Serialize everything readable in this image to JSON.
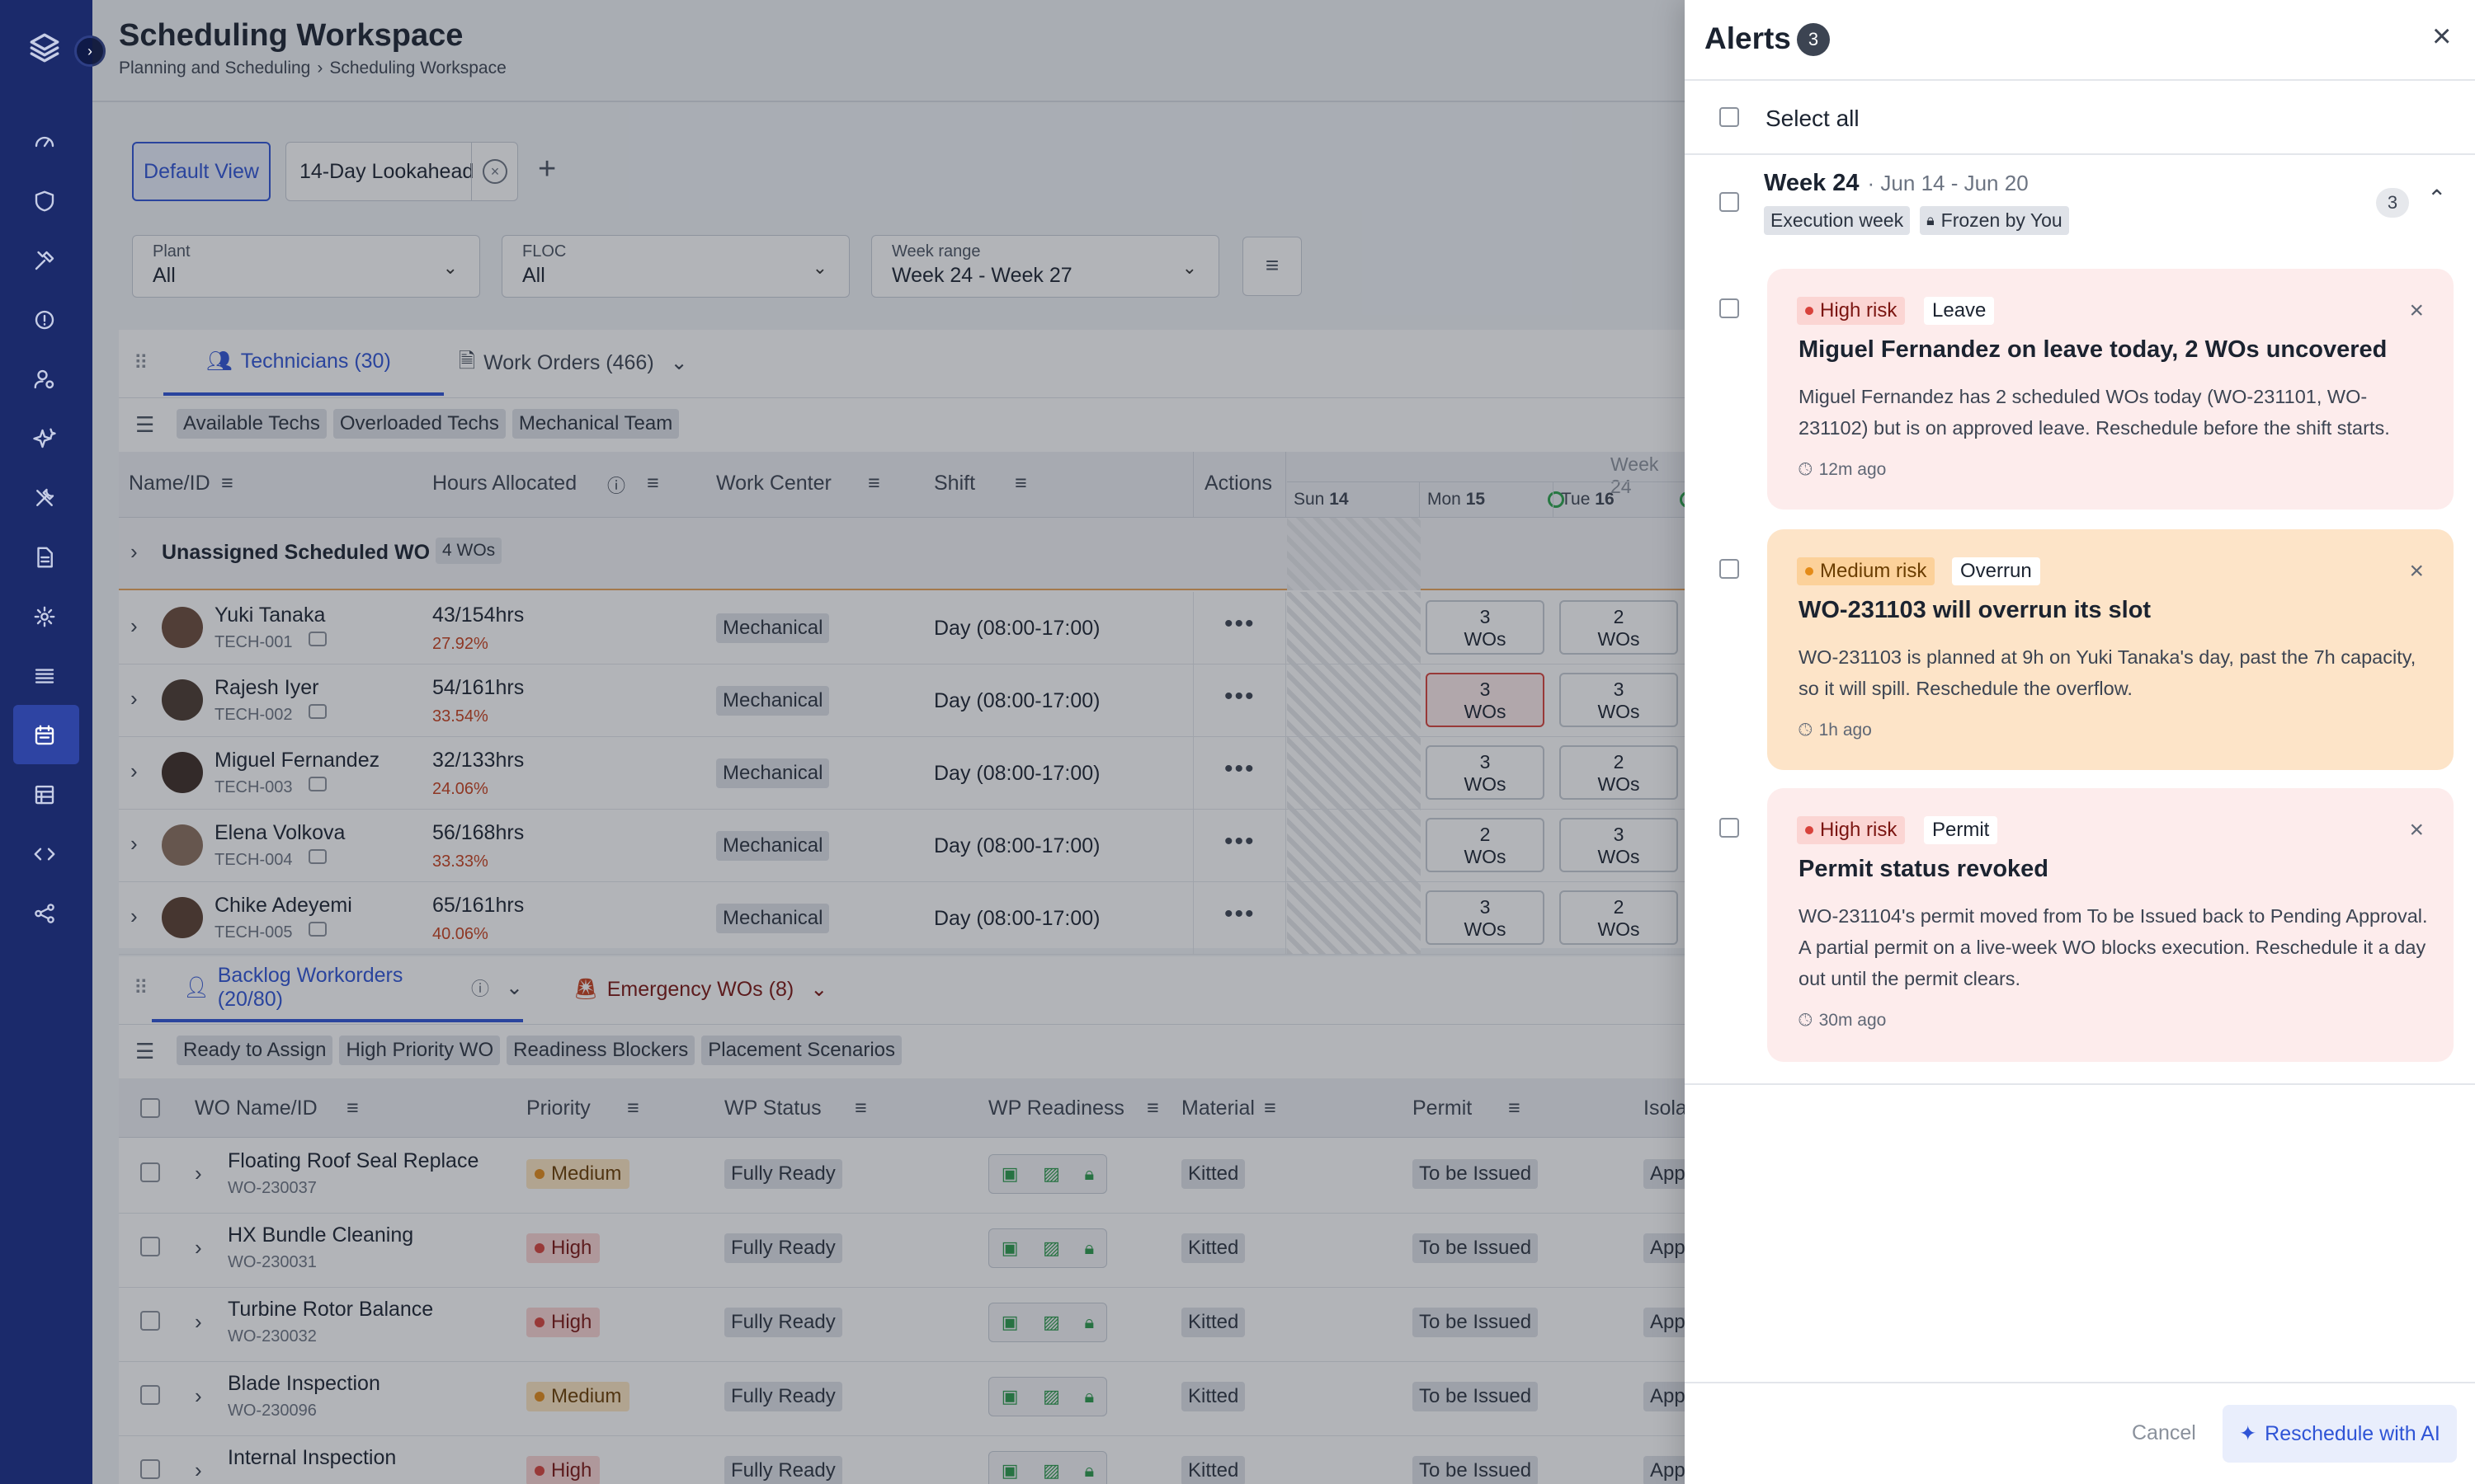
{
  "header": {
    "title": "Scheduling Workspace",
    "breadcrumb": [
      "Planning and Scheduling",
      "Scheduling Workspace"
    ]
  },
  "views": {
    "tabs": [
      {
        "label": "Default View",
        "active": true
      },
      {
        "label": "14-Day Lookahead",
        "active": false
      }
    ]
  },
  "filters": [
    {
      "label": "Plant",
      "value": "All"
    },
    {
      "label": "FLOC",
      "value": "All"
    },
    {
      "label": "Week range",
      "value": "Week 24 - Week 27"
    }
  ],
  "tech_panel": {
    "tabs": [
      {
        "label": "Technicians (30)",
        "active": true
      },
      {
        "label": "Work Orders (466)",
        "active": false
      }
    ],
    "chips": [
      "Available Techs",
      "Overloaded Techs",
      "Mechanical Team"
    ],
    "columns": [
      "Name/ID",
      "Hours Allocated",
      "Work Center",
      "Shift",
      "Actions"
    ],
    "week_label": "Week 24",
    "days": [
      {
        "dow": "Sun",
        "num": "14"
      },
      {
        "dow": "Mon",
        "num": "15"
      },
      {
        "dow": "Tue",
        "num": "16"
      }
    ],
    "unassigned": {
      "label": "Unassigned Scheduled WO",
      "count": "4 WOs"
    },
    "rows": [
      {
        "name": "Yuki Tanaka",
        "id": "TECH-001",
        "hours": "43/154hrs",
        "pct": "27.92%",
        "center": "Mechanical",
        "shift": "Day (08:00-17:00)",
        "mon": [
          "3",
          "WOs"
        ],
        "tue": [
          "2",
          "WOs"
        ]
      },
      {
        "name": "Rajesh Iyer",
        "id": "TECH-002",
        "hours": "54/161hrs",
        "pct": "33.54%",
        "center": "Mechanical",
        "shift": "Day (08:00-17:00)",
        "mon": [
          "3",
          "WOs"
        ],
        "tue": [
          "3",
          "WOs"
        ]
      },
      {
        "name": "Miguel Fernandez",
        "id": "TECH-003",
        "hours": "32/133hrs",
        "pct": "24.06%",
        "center": "Mechanical",
        "shift": "Day (08:00-17:00)",
        "mon": [
          "3",
          "WOs"
        ],
        "tue": [
          "2",
          "WOs"
        ]
      },
      {
        "name": "Elena Volkova",
        "id": "TECH-004",
        "hours": "56/168hrs",
        "pct": "33.33%",
        "center": "Mechanical",
        "shift": "Day (08:00-17:00)",
        "mon": [
          "2",
          "WOs"
        ],
        "tue": [
          "3",
          "WOs"
        ]
      },
      {
        "name": "Chike Adeyemi",
        "id": "TECH-005",
        "hours": "65/161hrs",
        "pct": "40.06%",
        "center": "Mechanical",
        "shift": "Day (08:00-17:00)",
        "mon": [
          "3",
          "WOs"
        ],
        "tue": [
          "2",
          "WOs"
        ]
      }
    ]
  },
  "backlog_panel": {
    "tabs": [
      {
        "label": "Backlog Workorders (20/80)",
        "active": true
      },
      {
        "label": "Emergency WOs (8)",
        "active": false
      }
    ],
    "chips": [
      "Ready to Assign",
      "High Priority WO",
      "Readiness Blockers",
      "Placement Scenarios"
    ],
    "columns": [
      "WO Name/ID",
      "Priority",
      "WP Status",
      "WP Readiness",
      "Material",
      "Permit",
      "Isola"
    ],
    "rows": [
      {
        "name": "Floating Roof Seal Replace",
        "id": "WO-230037",
        "priority": "Medium",
        "status": "Fully Ready",
        "material": "Kitted",
        "permit": "To be Issued",
        "iso": "App"
      },
      {
        "name": "HX Bundle Cleaning",
        "id": "WO-230031",
        "priority": "High",
        "status": "Fully Ready",
        "material": "Kitted",
        "permit": "To be Issued",
        "iso": "App"
      },
      {
        "name": "Turbine Rotor Balance",
        "id": "WO-230032",
        "priority": "High",
        "status": "Fully Ready",
        "material": "Kitted",
        "permit": "To be Issued",
        "iso": "App"
      },
      {
        "name": "Blade Inspection",
        "id": "WO-230096",
        "priority": "Medium",
        "status": "Fully Ready",
        "material": "Kitted",
        "permit": "To be Issued",
        "iso": "App"
      },
      {
        "name": "Internal Inspection",
        "id": "",
        "priority": "High",
        "status": "Fully Ready",
        "material": "Kitted",
        "permit": "To be Issued",
        "iso": "App"
      }
    ]
  },
  "alerts_panel": {
    "title": "Alerts",
    "count": "3",
    "select_all": "Select all",
    "week": {
      "title": "Week 24",
      "range": "· Jun 14 - Jun 20",
      "tags": [
        "Execution week",
        "Frozen by You"
      ],
      "count": "3"
    },
    "alerts": [
      {
        "risk": "High risk",
        "category": "Leave",
        "title": "Miguel Fernandez on leave today, 2 WOs uncovered",
        "description": "Miguel Fernandez has 2 scheduled WOs today (WO-231101, WO-231102) but is on approved leave. Reschedule before the shift starts.",
        "time": "12m ago"
      },
      {
        "risk": "Medium risk",
        "category": "Overrun",
        "title": "WO-231103 will overrun its slot",
        "description": "WO-231103 is planned at 9h on Yuki Tanaka's day, past the 7h capacity, so it will spill. Reschedule the overflow.",
        "time": "1h ago"
      },
      {
        "risk": "High risk",
        "category": "Permit",
        "title": "Permit status revoked",
        "description": "WO-231104's permit moved from To be Issued back to Pending Approval. A partial permit on a live-week WO blocks execution. Reschedule it a day out until the permit clears.",
        "time": "30m ago"
      }
    ],
    "footer": {
      "cancel": "Cancel",
      "primary": "Reschedule with AI"
    }
  },
  "colors": {
    "sidebar": "#1b2a6b",
    "accent": "#2f54d6",
    "high_risk_bg": "#fdecec",
    "medium_risk_bg": "#fde4c8"
  }
}
